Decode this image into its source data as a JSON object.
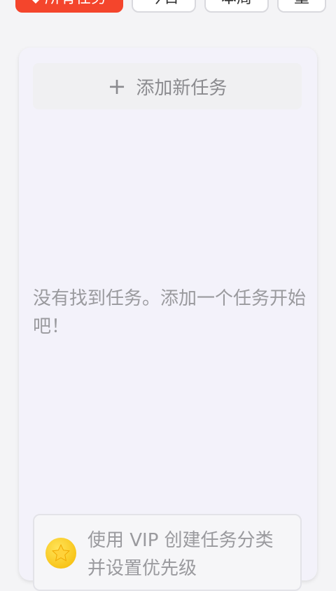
{
  "filters": {
    "tabs": [
      {
        "label": "所有任务"
      },
      {
        "label": "今日"
      },
      {
        "label": "本周"
      },
      {
        "label": "重"
      }
    ]
  },
  "task_list": {
    "add_label": "添加新任务",
    "empty_message": "没有找到任务。添加一个任务开始吧！"
  },
  "vip_banner": {
    "message": "使用 VIP 创建任务分类并设置优先级"
  },
  "colors": {
    "accent": "#f4452c",
    "card_bg": "#f3f2fa",
    "star": "#f5b800"
  }
}
